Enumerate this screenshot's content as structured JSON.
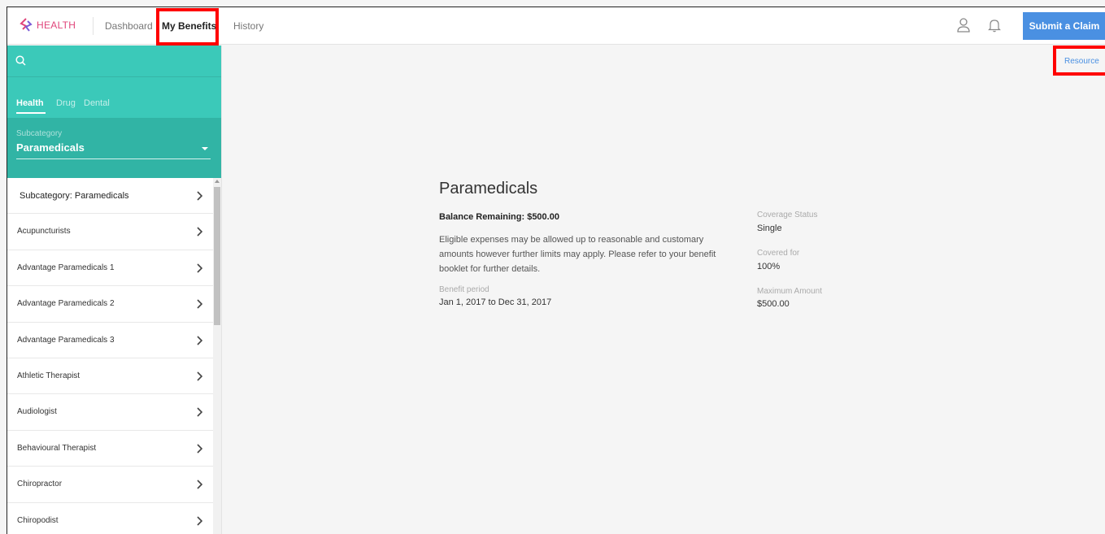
{
  "header": {
    "logo_text": "HEALTH",
    "nav": {
      "dashboard": "Dashboard",
      "my_benefits": "My Benefits",
      "history": "History"
    },
    "submit_claim": "Submit a Claim"
  },
  "sidebar": {
    "tabs": [
      "Health",
      "Drug",
      "Dental"
    ],
    "active_tab": "Health",
    "subcategory_label": "Subcategory",
    "subcategory_value": "Paramedicals",
    "items": [
      {
        "label": "Subcategory: Paramedicals"
      },
      {
        "label": "Acupuncturists"
      },
      {
        "label": "Advantage Paramedicals 1"
      },
      {
        "label": "Advantage Paramedicals 2"
      },
      {
        "label": "Advantage Paramedicals 3"
      },
      {
        "label": "Athletic Therapist"
      },
      {
        "label": "Audiologist"
      },
      {
        "label": "Behavioural Therapist"
      },
      {
        "label": "Chiropractor"
      },
      {
        "label": "Chiropodist"
      }
    ]
  },
  "main": {
    "resources_link": "Resource",
    "title": "Paramedicals",
    "balance": "Balance Remaining: $500.00",
    "description": "Eligible expenses may be allowed up to reasonable and customary amounts however further limits may apply. Please refer to your benefit booklet for further details.",
    "benefit_period_label": "Benefit period",
    "benefit_period_value": "Jan 1, 2017 to Dec 31, 2017",
    "coverage_status_label": "Coverage Status",
    "coverage_status_value": "Single",
    "covered_for_label": "Covered for",
    "covered_for_value": "100%",
    "maximum_amount_label": "Maximum Amount",
    "maximum_amount_value": "$500.00"
  },
  "colors": {
    "teal": "#3bc9b9",
    "teal_dark": "#31b4a5",
    "brand_pink": "#e0457b",
    "primary_blue": "#4a90e2",
    "annotation_red": "#ff0000"
  }
}
